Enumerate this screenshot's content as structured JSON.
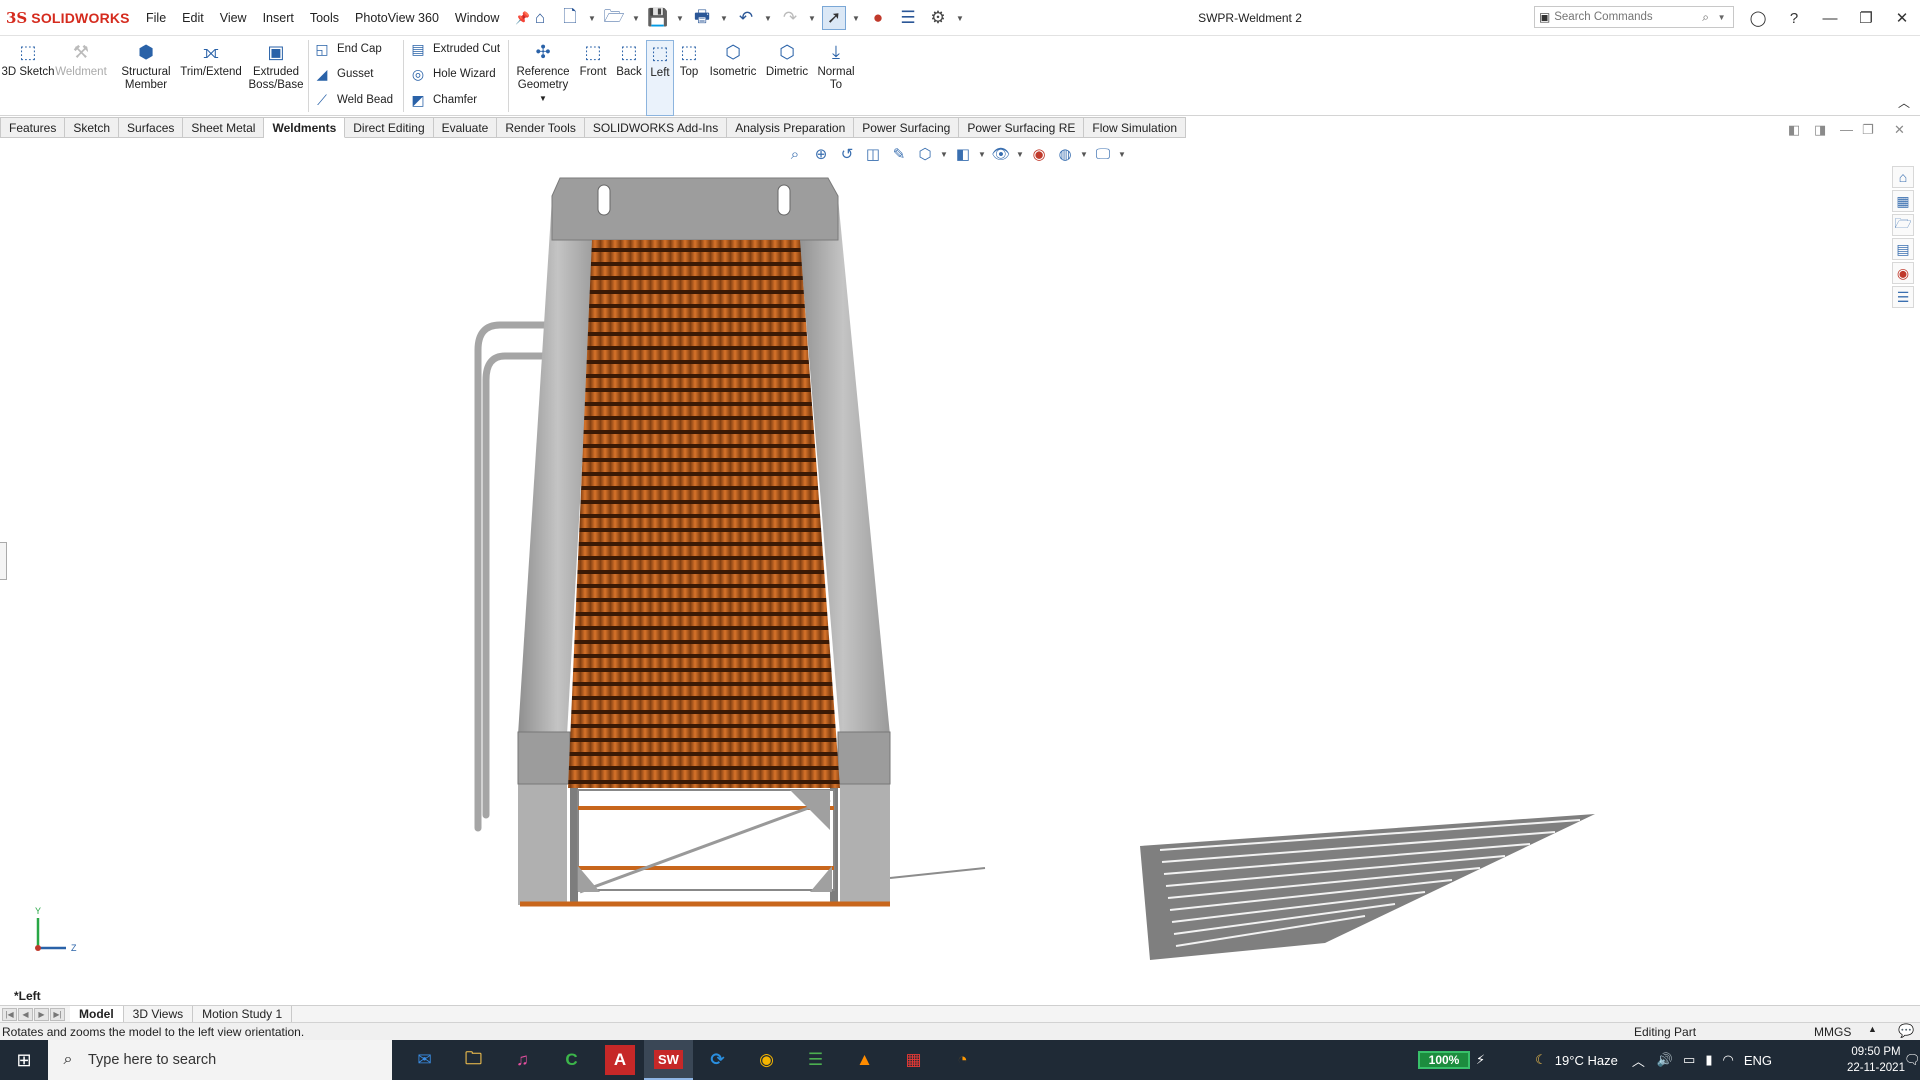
{
  "app": {
    "logo_ds": "3S",
    "logo_text": "SOLIDWORKS",
    "document_title": "SWPR-Weldment 2"
  },
  "menu": [
    "File",
    "Edit",
    "View",
    "Insert",
    "Tools",
    "PhotoView 360",
    "Window"
  ],
  "search": {
    "placeholder": "Search Commands"
  },
  "command_manager": {
    "sketch_3d": "3D Sketch",
    "weldment": "Weldment",
    "structural_member": "Structural Member",
    "trim_extend": "Trim/Extend",
    "extruded_boss": "Extruded Boss/Base",
    "end_cap": "End Cap",
    "gusset": "Gusset",
    "weld_bead": "Weld Bead",
    "extruded_cut": "Extruded Cut",
    "hole_wizard": "Hole Wizard",
    "chamfer": "Chamfer",
    "reference_geometry": "Reference Geometry",
    "front": "Front",
    "back": "Back",
    "left": "Left",
    "top": "Top",
    "isometric": "Isometric",
    "dimetric": "Dimetric",
    "normal_to": "Normal To"
  },
  "tabs": [
    "Features",
    "Sketch",
    "Surfaces",
    "Sheet Metal",
    "Weldments",
    "Direct Editing",
    "Evaluate",
    "Render Tools",
    "SOLIDWORKS Add-Ins",
    "Analysis Preparation",
    "Power Surfacing",
    "Power Surfacing RE",
    "Flow Simulation"
  ],
  "active_tab": "Weldments",
  "triad": {
    "y": "Y",
    "z": "Z"
  },
  "view_name": "*Left",
  "bottom_tabs": [
    "Model",
    "3D Views",
    "Motion Study 1"
  ],
  "status": {
    "message": "Rotates and zooms the model to the left view orientation.",
    "mode": "Editing Part",
    "units": "MMGS"
  },
  "taskbar": {
    "search_placeholder": "Type here to search",
    "battery": "100%",
    "weather": "19°C  Haze",
    "language": "ENG",
    "time": "09:50 PM",
    "date": "22-11-2021"
  },
  "colors": {
    "brand": "#d52b1e",
    "accent": "#2a62a8",
    "wood": "#c8661c",
    "steel": "#a9a9a9"
  }
}
